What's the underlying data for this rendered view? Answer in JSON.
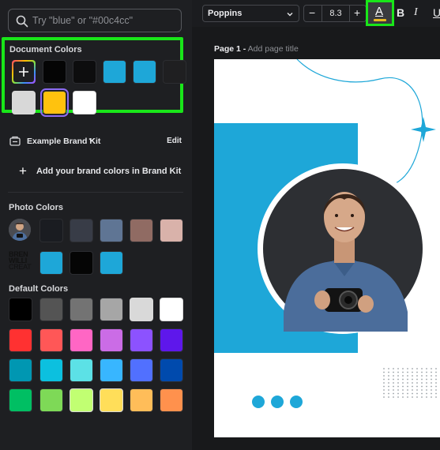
{
  "search": {
    "placeholder": "Try \"blue\" or \"#00c4cc\""
  },
  "document_colors": {
    "title": "Document Colors",
    "swatches": [
      "#050505",
      "#0d0d0e",
      "#1ea7d8",
      "#1ea7d8",
      "#1f1f21",
      "#d8d8d8",
      "#ffc20e",
      "#ffffff"
    ],
    "selected_index": 6
  },
  "brand_kit": {
    "name": "Example Brand Kit",
    "edit_label": "Edit",
    "add_label": "Add your brand colors in Brand Kit"
  },
  "photo_colors": {
    "title": "Photo Colors",
    "row1": [
      "#1a1c21",
      "#383c47",
      "#5f7594",
      "#906b63",
      "#d9b2aa"
    ],
    "row2": [
      "#1ea7d8",
      "#050505",
      "#1ea7d8"
    ],
    "logo_text": [
      "BREN",
      "WILLI",
      "CREAT"
    ]
  },
  "default_colors": {
    "title": "Default Colors",
    "rows": [
      [
        "#000000",
        "#545454",
        "#737373",
        "#a6a6a6",
        "#d9d9d9",
        "#ffffff"
      ],
      [
        "#ff3131",
        "#ff5757",
        "#ff66c4",
        "#cb6ce6",
        "#8c52ff",
        "#5e17eb"
      ],
      [
        "#0097b2",
        "#0cc0df",
        "#5ce1e6",
        "#38b6ff",
        "#5170ff",
        "#004aad"
      ],
      [
        "#00bf63",
        "#7ed957",
        "#c1ff72",
        "#ffde59",
        "#ffbd59",
        "#ff914d"
      ]
    ]
  },
  "toolbar": {
    "font": "Poppins",
    "size_minus": "−",
    "size": "8.3",
    "size_plus": "+",
    "text_color_letter": "A",
    "bold": "B",
    "italic": "I",
    "underline": "U"
  },
  "page": {
    "number": "Page 1 -",
    "title_placeholder": "Add page title"
  },
  "design": {
    "accent": "#1ea7d8",
    "dot_count": 3
  }
}
